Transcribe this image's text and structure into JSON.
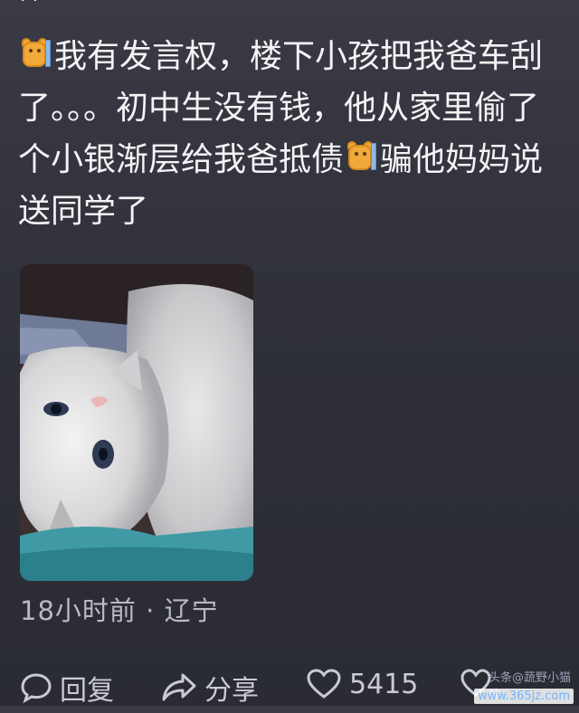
{
  "header": {
    "username": "??",
    "more_icon": "more-dots-icon"
  },
  "post": {
    "segments": [
      {
        "type": "emoji",
        "name": "cat-emoji-icon"
      },
      {
        "type": "text",
        "value": "我有发言权，楼下小孩把我爸车刮了。。。初中生没有钱，他从家里偷了个小银渐层给我爸抵债"
      },
      {
        "type": "emoji",
        "name": "cat-emoji-icon"
      },
      {
        "type": "text",
        "value": "骗他妈妈说送同学了"
      }
    ],
    "image_desc_icon": "cat-photo"
  },
  "meta": {
    "time": "18小时前",
    "separator": "·",
    "location": "辽宁"
  },
  "actions": {
    "reply_label": "回复",
    "share_label": "分享",
    "like_count": "5415"
  },
  "watermark": {
    "text": "www.365jz.com",
    "sub": "头条@蔬野小猫咪"
  },
  "colors": {
    "background_top": "#3a3a45",
    "background_bottom": "#2a2b33",
    "text_primary": "#f4f4f6",
    "text_secondary": "#b9bac3",
    "emoji_orange": "#f1a93a"
  }
}
